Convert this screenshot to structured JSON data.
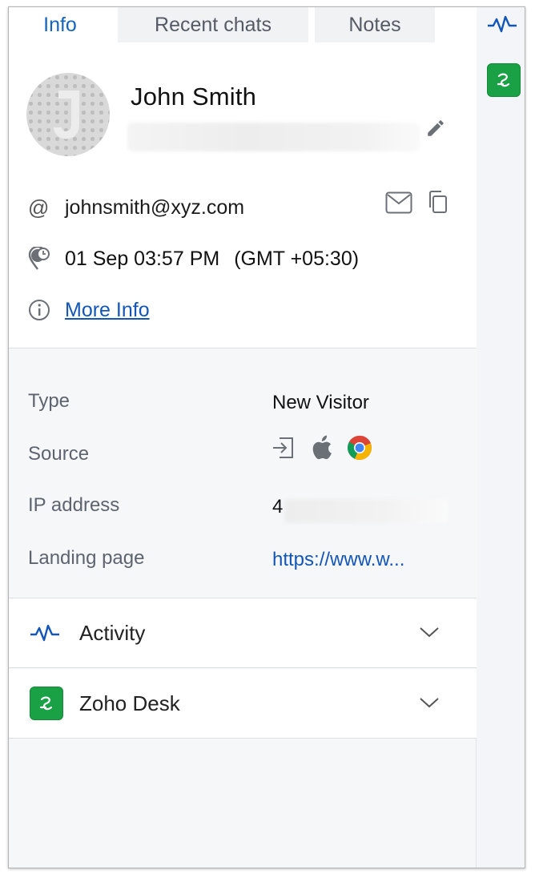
{
  "tabs": [
    {
      "label": "Info",
      "active": true
    },
    {
      "label": "Recent chats",
      "active": false
    },
    {
      "label": "Notes",
      "active": false
    }
  ],
  "contact": {
    "name": "John Smith",
    "email": "johnsmith@xyz.com",
    "email_prefix_symbol": "@",
    "local_time": "01 Sep 03:57 PM",
    "timezone": "(GMT +05:30)",
    "more_info_label": "More Info"
  },
  "details": {
    "rows": [
      {
        "key": "Type",
        "value": "New Visitor"
      },
      {
        "key": "Source",
        "value": ""
      },
      {
        "key": "IP address",
        "value": "4"
      },
      {
        "key": "Landing page",
        "value": "https://www.w..."
      }
    ],
    "source_icons": [
      "sign-in-icon",
      "apple-icon",
      "chrome-icon"
    ]
  },
  "accordions": [
    {
      "label": "Activity",
      "icon": "activity-pulse-icon"
    },
    {
      "label": "Zoho Desk",
      "icon": "zoho-desk-icon"
    }
  ],
  "colors": {
    "accent_blue": "#1565c0",
    "link_blue": "#1356b8",
    "zoho_green": "#1ba145"
  }
}
